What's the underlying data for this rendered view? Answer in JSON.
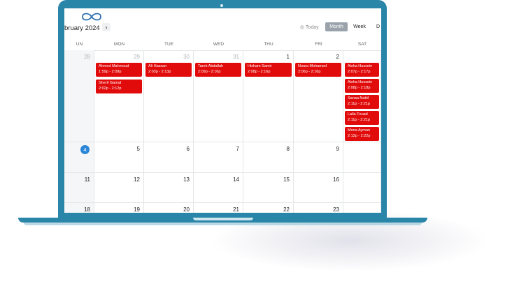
{
  "toolbar": {
    "month_title": "bruary 2024",
    "next_symbol": "›",
    "today_label": "◎ Today",
    "view_month": "Month",
    "view_week": "Week",
    "view_day": "D"
  },
  "weekdays": [
    "UN",
    "MON",
    "TUE",
    "WED",
    "THU",
    "FRI",
    "SAT"
  ],
  "weeks": [
    [
      "28",
      "29",
      "30",
      "31",
      "1",
      "2",
      ""
    ],
    [
      "4",
      "5",
      "6",
      "7",
      "8",
      "9",
      ""
    ],
    [
      "11",
      "12",
      "13",
      "14",
      "15",
      "16",
      ""
    ],
    [
      "18",
      "19",
      "20",
      "21",
      "22",
      "23",
      ""
    ]
  ],
  "muted_days_week0": [
    0,
    1,
    2,
    3
  ],
  "today": "4",
  "events": {
    "mon": [
      {
        "name": "Ahmed Mahmoud",
        "time": "1:59p - 2:09p"
      },
      {
        "name": "Sherif Gamal",
        "time": "2:02p - 2:12p"
      }
    ],
    "tue": [
      {
        "name": "Ali Hassan",
        "time": "2:03p - 2:13p"
      }
    ],
    "wed": [
      {
        "name": "Tarek Abdallah",
        "time": "2:09p - 2:16p"
      }
    ],
    "thu": [
      {
        "name": "Hisham Samir",
        "time": "2:08p - 2:16p"
      }
    ],
    "fri": [
      {
        "name": "Noura Mohamed",
        "time": "2:06p - 2:16p"
      }
    ],
    "sat": [
      {
        "name": "Aisha Hussein",
        "time": "2:07p - 2:17p"
      },
      {
        "name": "Aisha Hussein",
        "time": "2:08p - 2:18p"
      },
      {
        "name": "Sanaa Nabil",
        "time": "2:11p - 2:21p"
      },
      {
        "name": "Laila Fouad",
        "time": "2:11p - 2:21p"
      },
      {
        "name": "Mona Ayman",
        "time": "2:12p - 2:22p"
      }
    ]
  },
  "colors": {
    "laptop": "#2a86a8",
    "event": "#e10b0b",
    "today_badge": "#2b86d8",
    "active_view": "#9aa3ab"
  }
}
